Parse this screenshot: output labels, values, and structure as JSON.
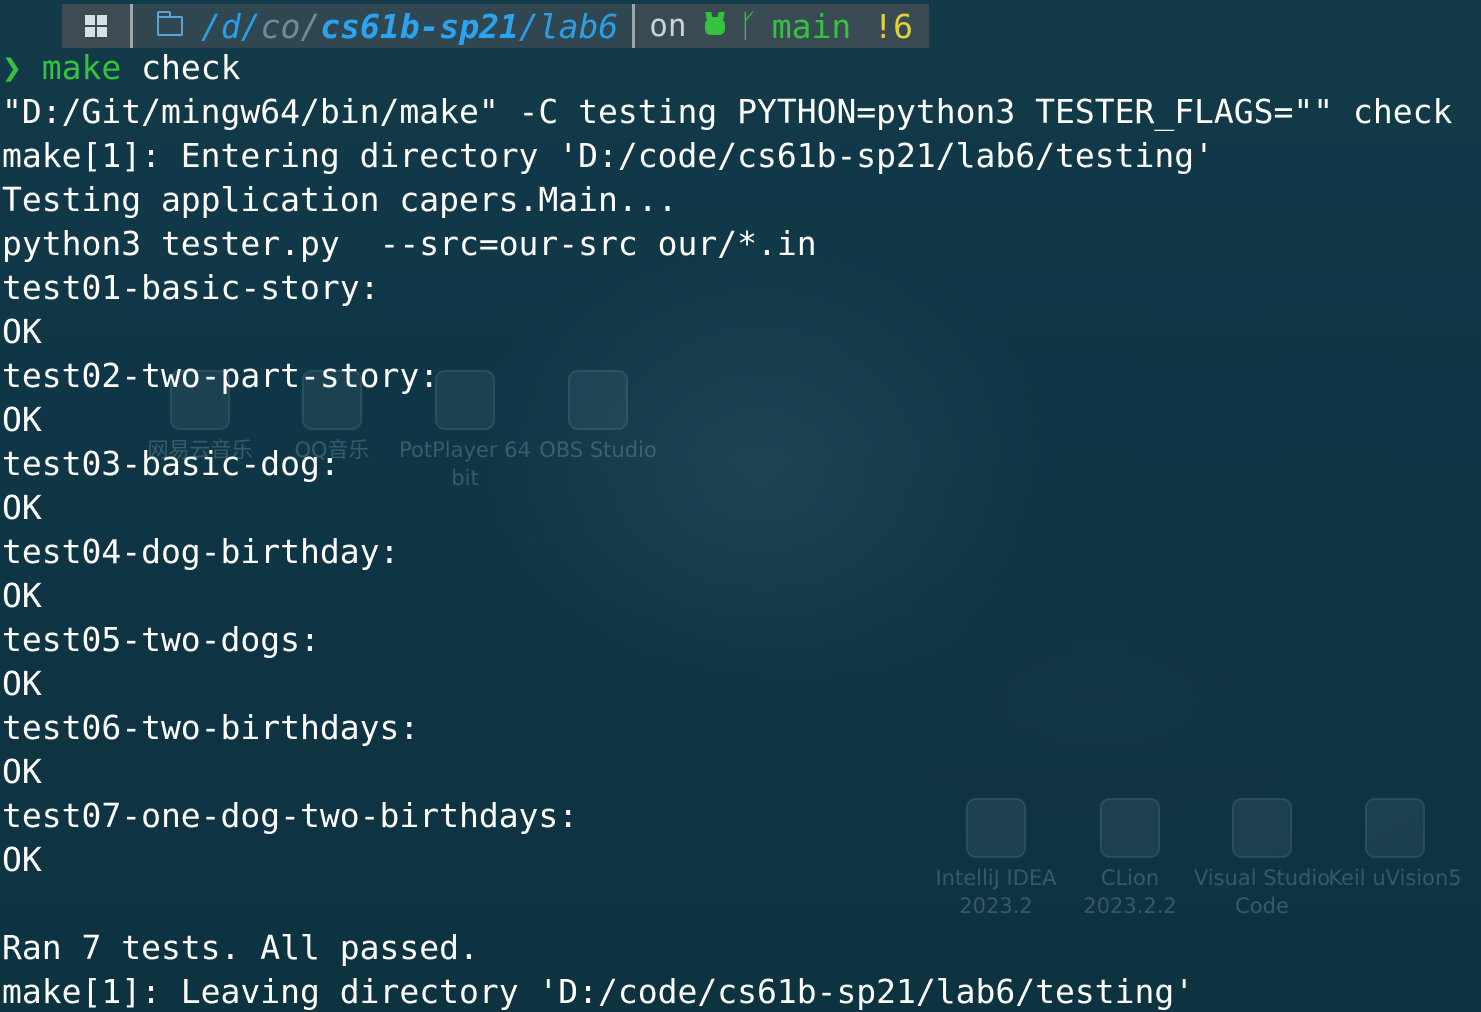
{
  "prompt": {
    "os_icon": "windows-icon",
    "folder_icon": "folder-icon",
    "path_prefix": "/d/",
    "path_mid": "co/",
    "path_repo": "cs61b-sp21",
    "path_tail": "/lab6",
    "on_label": "on",
    "github_icon": "github-icon",
    "branch_icon": "git-branch-icon",
    "branch": "main",
    "status": "!6",
    "colors": {
      "path": "#2a9ee6",
      "git": "#34c340",
      "status": "#e0d23a"
    }
  },
  "terminal": {
    "prompt_symbol": "❯",
    "command_name": "make",
    "command_args": "check",
    "lines": [
      "\"D:/Git/mingw64/bin/make\" -C testing PYTHON=python3 TESTER_FLAGS=\"\" check",
      "make[1]: Entering directory 'D:/code/cs61b-sp21/lab6/testing'",
      "Testing application capers.Main...",
      "python3 tester.py  --src=our-src our/*.in",
      "test01-basic-story:",
      "OK",
      "test02-two-part-story:",
      "OK",
      "test03-basic-dog:",
      "OK",
      "test04-dog-birthday:",
      "OK",
      "test05-two-dogs:",
      "OK",
      "test06-two-birthdays:",
      "OK",
      "test07-one-dog-two-birthdays:",
      "OK",
      "",
      "Ran 7 tests. All passed.",
      "make[1]: Leaving directory 'D:/code/cs61b-sp21/lab6/testing'"
    ]
  },
  "desktop_ghost_icons": [
    {
      "label": "网易云音乐"
    },
    {
      "label": "QQ音乐"
    },
    {
      "label": "PotPlayer 64 bit"
    },
    {
      "label": "OBS Studio"
    },
    {
      "label": "IntelliJ IDEA 2023.2"
    },
    {
      "label": "CLion 2023.2.2"
    },
    {
      "label": "Visual Studio Code"
    },
    {
      "label": "Keil uVision5"
    }
  ]
}
